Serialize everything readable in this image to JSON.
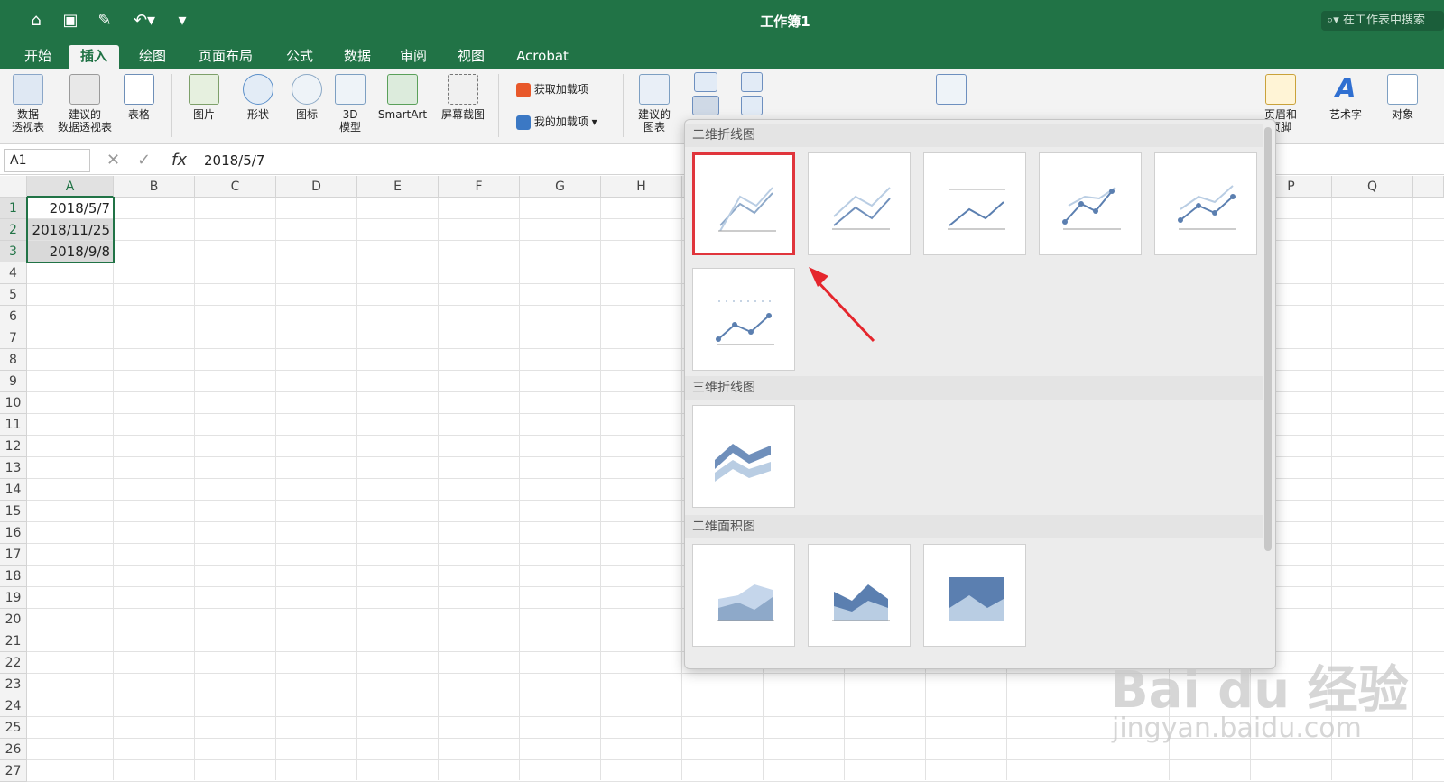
{
  "window": {
    "title": "工作簿1",
    "search_placeholder": "在工作表中搜索",
    "accent": "#217346"
  },
  "menu_tabs": [
    {
      "label": "开始"
    },
    {
      "label": "插入",
      "active": true
    },
    {
      "label": "绘图"
    },
    {
      "label": "页面布局"
    },
    {
      "label": "公式"
    },
    {
      "label": "数据"
    },
    {
      "label": "审阅"
    },
    {
      "label": "视图"
    },
    {
      "label": "Acrobat"
    }
  ],
  "ribbon": {
    "pivot": "数据\n透视表",
    "recommended_pivot": "建议的\n数据透视表",
    "table": "表格",
    "picture": "图片",
    "shapes": "形状",
    "icons": "图标",
    "model3d": "3D\n模型",
    "smartart": "SmartArt",
    "screenshot": "屏幕截图",
    "get_addins": "获取加载项",
    "my_addins": "我的加载项",
    "recommended_chart": "建议的\n图表",
    "header_footer": "页眉和\n页脚",
    "wordart": "艺术字",
    "object": "对象"
  },
  "formula_bar": {
    "name_box": "A1",
    "fx": "fx",
    "value": "2018/5/7"
  },
  "columns": [
    "A",
    "B",
    "C",
    "D",
    "E",
    "F",
    "G",
    "H",
    "",
    "",
    "",
    "",
    "",
    "",
    "",
    "P",
    "Q"
  ],
  "rows": [
    "1",
    "2",
    "3",
    "4",
    "5",
    "6",
    "7",
    "8",
    "9",
    "10",
    "11",
    "12",
    "13",
    "14",
    "15",
    "16",
    "17",
    "18",
    "19",
    "20",
    "21",
    "22",
    "23",
    "24",
    "25",
    "26",
    "27"
  ],
  "cells": {
    "A1": "2018/5/7",
    "A2": "2018/11/25",
    "A3": "2018/9/8"
  },
  "chart_gallery": {
    "section_2d_line": "二维折线图",
    "section_3d_line": "三维折线图",
    "section_2d_area": "二维面积图"
  },
  "watermark": {
    "brand": "Bai du 经验",
    "url": "jingyan.baidu.com"
  }
}
